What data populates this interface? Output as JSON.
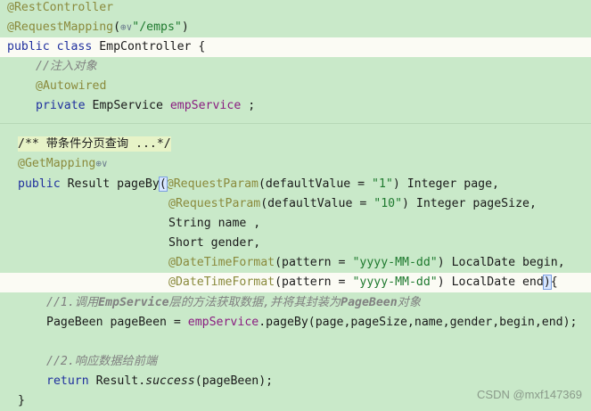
{
  "code": {
    "ann_restcontroller": "@RestController",
    "ann_requestmapping": "@RequestMapping",
    "requestmapping_paren_open": "(",
    "web_icon_glyph": "⊕∨",
    "requestmapping_path": "\"/emps\"",
    "requestmapping_paren_close": ")",
    "kw_public": "public",
    "kw_class": "class",
    "class_decl_rest": " EmpController {",
    "comment_inject": "//注入对象",
    "ann_autowired": "@Autowired",
    "kw_private": "private",
    "field_type": " EmpService ",
    "field_name": "empService",
    "field_end": " ;",
    "doc_comment": "/** 带条件分页查询 ...*/",
    "ann_getmapping": "@GetMapping",
    "method_sig_result": " Result ",
    "method_name": "pageBy",
    "method_open_paren": "(",
    "ann_requestparam_1": "@RequestParam",
    "param1_a": "(defaultValue = ",
    "param1_val": "\"1\"",
    "param1_b": ") Integer page,",
    "ann_requestparam_2": "@RequestParam",
    "param2_a": "(defaultValue = ",
    "param2_val": "\"10\"",
    "param2_b": ") Integer pageSize,",
    "param3": "String name ,",
    "param4": "Short gender,",
    "ann_datetime_1": "@DateTimeFormat",
    "param5_a": "(pattern = ",
    "param5_val": "\"yyyy-MM-dd\"",
    "param5_b": ") LocalDate begin,",
    "ann_datetime_2": "@DateTimeFormat",
    "param6_a": "(pattern = ",
    "param6_val": "\"yyyy-MM-dd\"",
    "param6_b": ") LocalDate end",
    "param6_close": ")",
    "param6_brace": "{",
    "comment_step1_a": "//1.调用",
    "comment_step1_b": "EmpService",
    "comment_step1_c": "层的方法获取数据,并将其封装为",
    "comment_step1_d": "PageBeen",
    "comment_step1_e": "对象",
    "stmt_pagebeen_a": "PageBeen pageBeen = ",
    "stmt_pagebeen_field": "empService",
    "stmt_pagebeen_b": ".pageBy(page,pageSize,name,gender,begin,end);",
    "comment_step2": "//2.响应数据给前端",
    "kw_return": "return",
    "return_a": " Result.",
    "return_method": "success",
    "return_b": "(pageBeen);",
    "closing_brace": "}"
  },
  "watermark": "CSDN @mxf147369"
}
